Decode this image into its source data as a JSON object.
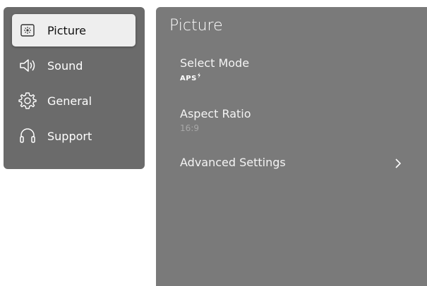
{
  "sidebar": {
    "items": [
      {
        "label": "Picture",
        "icon": "picture-icon",
        "active": true
      },
      {
        "label": "Sound",
        "icon": "speaker-icon",
        "active": false
      },
      {
        "label": "General",
        "icon": "gear-icon",
        "active": false
      },
      {
        "label": "Support",
        "icon": "headset-icon",
        "active": false
      }
    ]
  },
  "panel": {
    "title": "Picture",
    "settings": [
      {
        "label": "Select Mode",
        "value": "APS",
        "icon": "aps-logo"
      },
      {
        "label": "Aspect Ratio",
        "value": "16:9"
      },
      {
        "label": "Advanced Settings",
        "icon": "chevron-right-icon"
      }
    ]
  }
}
